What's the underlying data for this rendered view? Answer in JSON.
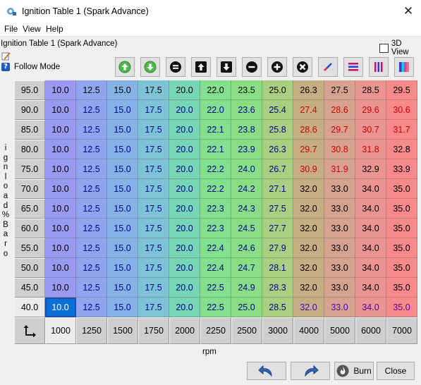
{
  "window": {
    "title": "Ignition Table 1 (Spark Advance)",
    "close_label": "✕"
  },
  "menu": [
    "File",
    "View",
    "Help"
  ],
  "table_title": "Ignition Table 1 (Spark Advance)",
  "view3d_label": "3D View",
  "follow_mode_label": "Follow Mode",
  "toolbar_icons": [
    "increase-icon",
    "decrease-icon",
    "set-value-icon",
    "shift-up-icon",
    "shift-down-icon",
    "subtract-icon",
    "add-icon",
    "multiply-icon",
    "interpolate-icon",
    "interpolate-horizontal-icon",
    "interpolate-vertical-icon",
    "color-scale-icon"
  ],
  "y_axis_label": "ignload%Baro",
  "x_axis_label": "rpm",
  "y_axis": [
    "95.0",
    "90.0",
    "85.0",
    "80.0",
    "75.0",
    "70.0",
    "65.0",
    "60.0",
    "55.0",
    "50.0",
    "45.0",
    "40.0"
  ],
  "x_axis": [
    "1000",
    "1250",
    "1500",
    "1750",
    "2000",
    "2250",
    "2500",
    "3000",
    "4000",
    "5000",
    "6000",
    "7000"
  ],
  "rows": [
    [
      "10.0",
      "12.5",
      "15.0",
      "17.5",
      "20.0",
      "22.0",
      "23.5",
      "25.0",
      "26.3",
      "27.5",
      "28.5",
      "29.5"
    ],
    [
      "10.0",
      "12.5",
      "15.0",
      "17.5",
      "20.0",
      "22.0",
      "23.6",
      "25.4",
      "27.4",
      "28.6",
      "29.6",
      "30.6"
    ],
    [
      "10.0",
      "12.5",
      "15.0",
      "17.5",
      "20.0",
      "22.1",
      "23.8",
      "25.8",
      "28.6",
      "29.7",
      "30.7",
      "31.7"
    ],
    [
      "10.0",
      "12.5",
      "15.0",
      "17.5",
      "20.0",
      "22.1",
      "23.9",
      "26.3",
      "29.7",
      "30.8",
      "31.8",
      "32.8"
    ],
    [
      "10.0",
      "12.5",
      "15.0",
      "17.5",
      "20.0",
      "22.2",
      "24.0",
      "26.7",
      "30.9",
      "31.9",
      "32.9",
      "33.9"
    ],
    [
      "10.0",
      "12.5",
      "15.0",
      "17.5",
      "20.0",
      "22.2",
      "24.2",
      "27.1",
      "32.0",
      "33.0",
      "34.0",
      "35.0"
    ],
    [
      "10.0",
      "12.5",
      "15.0",
      "17.5",
      "20.0",
      "22.3",
      "24.3",
      "27.5",
      "32.0",
      "33.0",
      "34.0",
      "35.0"
    ],
    [
      "10.0",
      "12.5",
      "15.0",
      "17.5",
      "20.0",
      "22.3",
      "24.5",
      "27.7",
      "32.0",
      "33.0",
      "34.0",
      "35.0"
    ],
    [
      "10.0",
      "12.5",
      "15.0",
      "17.5",
      "20.0",
      "22.4",
      "24.6",
      "27.9",
      "32.0",
      "33.0",
      "34.0",
      "35.0"
    ],
    [
      "10.0",
      "12.5",
      "15.0",
      "17.5",
      "20.0",
      "22.4",
      "24.7",
      "28.1",
      "32.0",
      "33.0",
      "34.0",
      "35.0"
    ],
    [
      "10.0",
      "12.5",
      "15.0",
      "17.5",
      "20.0",
      "22.5",
      "24.9",
      "28.3",
      "32.0",
      "33.0",
      "34.0",
      "35.0"
    ],
    [
      "10.0",
      "12.5",
      "15.0",
      "17.5",
      "20.0",
      "22.5",
      "25.0",
      "28.5",
      "32.0",
      "33.0",
      "34.0",
      "35.0"
    ]
  ],
  "column_colors": [
    "#9a9af2",
    "#8fa6ee",
    "#86b2e6",
    "#7dc4d6",
    "#77d6b5",
    "#82e08e",
    "#8ade84",
    "#a9cf80",
    "#c6ae84",
    "#d8a290",
    "#ea9592",
    "#f88a8a"
  ],
  "selected_cell": {
    "row": 11,
    "col": 0
  },
  "buttons": {
    "undo": "undo-icon",
    "redo": "redo-icon",
    "burn": "Burn",
    "close": "Close"
  }
}
